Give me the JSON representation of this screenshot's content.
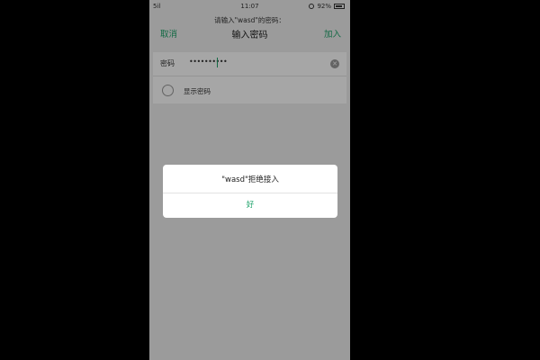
{
  "status_bar": {
    "signal": "5il",
    "time": "11:07",
    "battery": "92%"
  },
  "nav": {
    "prompt": "请输入\"wasd\"的密码：",
    "title": "输入密码",
    "cancel_label": "取消",
    "join_label": "加入"
  },
  "form": {
    "password_label": "密码",
    "password_value": "••••••••••",
    "show_password_label": "显示密码"
  },
  "dialog": {
    "message": "\"wasd\"拒绝接入",
    "ok_label": "好"
  },
  "colors": {
    "accent": "#1fa36b",
    "background": "#eeeeee"
  }
}
